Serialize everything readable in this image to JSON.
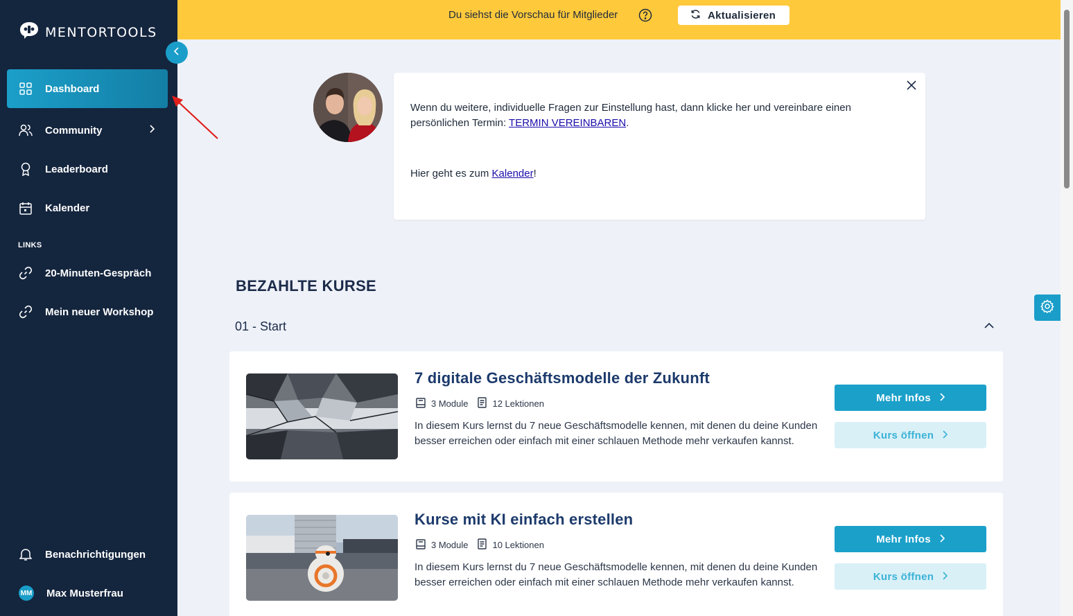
{
  "brand": {
    "name": "MENTORTOOLS"
  },
  "sidebar": {
    "items": [
      {
        "label": "Dashboard",
        "icon": "grid-icon"
      },
      {
        "label": "Community",
        "icon": "users-icon"
      },
      {
        "label": "Leaderboard",
        "icon": "award-icon"
      },
      {
        "label": "Kalender",
        "icon": "calendar-icon"
      }
    ],
    "links_label": "LINKS",
    "links": [
      {
        "label": "20-Minuten-Gespräch",
        "icon": "link-icon"
      },
      {
        "label": "Mein neuer Workshop",
        "icon": "link-icon"
      }
    ],
    "notifications_label": "Benachrichtigungen",
    "user": {
      "initials": "MM",
      "name": "Max Musterfrau"
    }
  },
  "banner": {
    "text": "Du siehst die Vorschau für Mitglieder",
    "refresh_label": "Aktualisieren",
    "color": "#ffc93c"
  },
  "info": {
    "p1_text": "Wenn du weitere, individuelle Fragen zur Einstellung hast, dann klicke her und vereinbare einen persönlichen Termin: ",
    "p1_link": "TERMIN VEREINBAREN",
    "p1_end": ".",
    "p2_text": "Hier geht es zum ",
    "p2_link": "Kalender",
    "p2_end": "!"
  },
  "section": {
    "title": "BEZAHLTE KURSE",
    "group": "01 - Start"
  },
  "courses": [
    {
      "title": "7 digitale Geschäftsmodelle der Zukunft",
      "modules": "3 Module",
      "lessons": "12 Lektionen",
      "description": "In diesem Kurs lernst du 7 neue Geschäftsmodelle kennen, mit denen du deine Kunden besser erreichen oder einfach mit einer schlauen Methode mehr verkaufen kannst.",
      "more_label": "Mehr Infos",
      "open_label": "Kurs öffnen"
    },
    {
      "title": "Kurse mit KI einfach erstellen",
      "modules": "3 Module",
      "lessons": "10 Lektionen",
      "description": "In diesem Kurs lernst du 7 neue Geschäftsmodelle kennen, mit denen du deine Kunden besser erreichen oder einfach mit einer schlauen Methode mehr verkaufen kannst.",
      "more_label": "Mehr Infos",
      "open_label": "Kurs öffnen"
    }
  ],
  "colors": {
    "sidebar": "#14253e",
    "accent": "#1ba0ca",
    "background": "#eef2f8"
  }
}
